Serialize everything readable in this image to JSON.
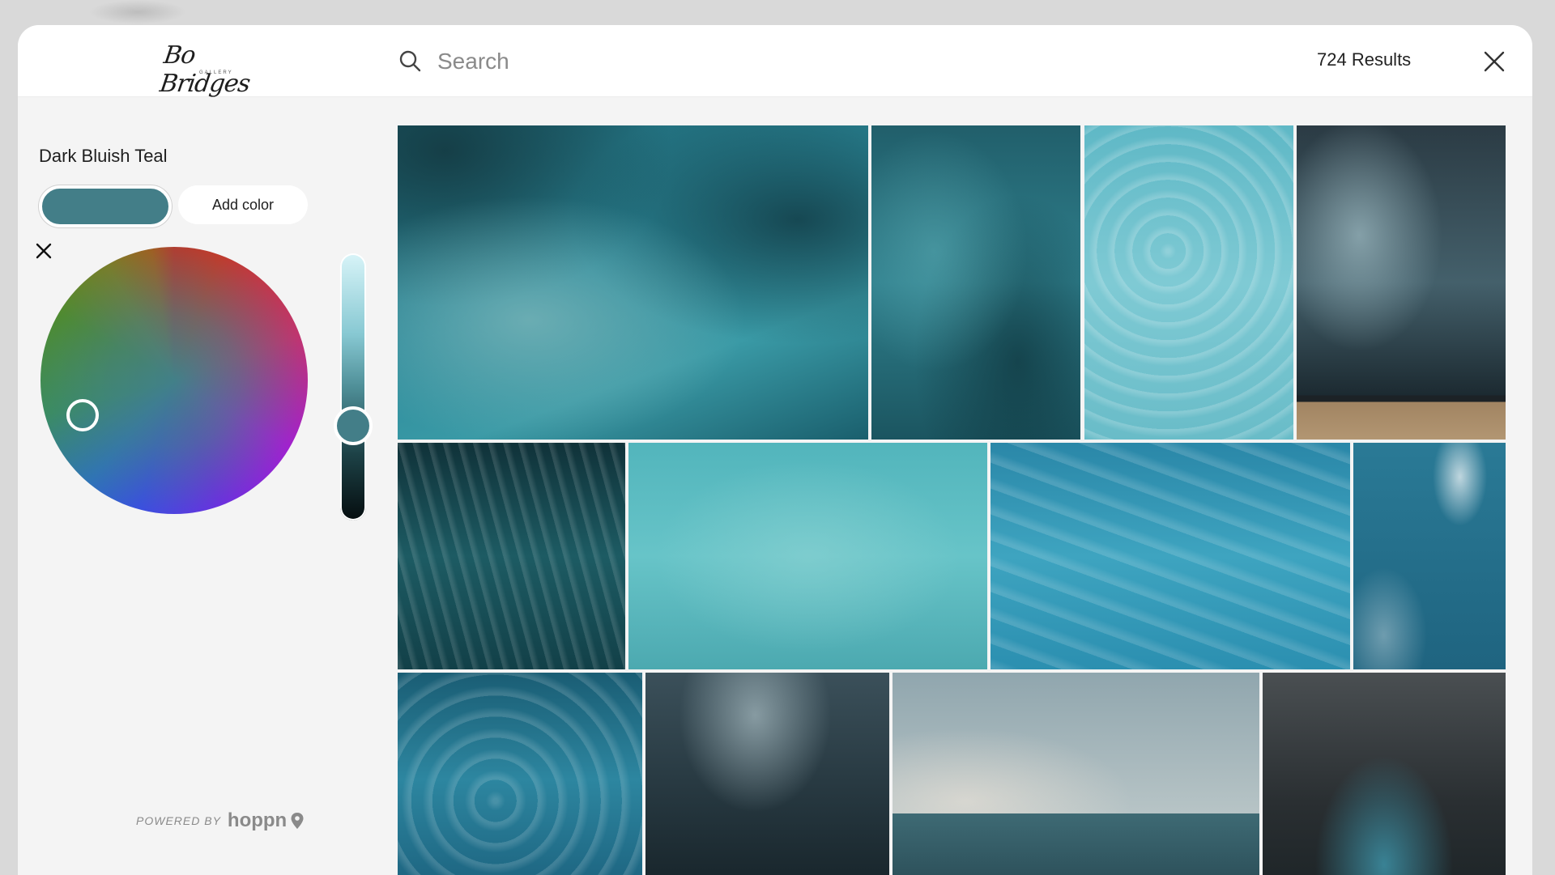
{
  "header": {
    "logo_text": "Bo Bridges",
    "logo_subtext": "GALLERY",
    "search_placeholder": "Search",
    "results_label": "724 Results",
    "icons": {
      "search": "search-icon",
      "close": "close-icon"
    }
  },
  "picker": {
    "color_name": "Dark Bluish Teal",
    "add_color_label": "Add color",
    "selected_color": "#437e88",
    "icons": {
      "remove": "close-icon"
    }
  },
  "footer": {
    "powered_prefix": "POWERED BY",
    "powered_brand": "hoppn",
    "icons": {
      "brand": "location-pin-icon"
    }
  },
  "gallery": {
    "items": [
      {
        "id": "aerial-reef-boat"
      },
      {
        "id": "aerial-reef-swimmer"
      },
      {
        "id": "sharks-shallow-water"
      },
      {
        "id": "rainbow-lifeguard-tower"
      },
      {
        "id": "surfers-whitewater-dark"
      },
      {
        "id": "surfers-turquoise-lineup"
      },
      {
        "id": "surfers-blue-waves"
      },
      {
        "id": "open-ocean-wave"
      },
      {
        "id": "surfers-crashing-wave"
      },
      {
        "id": "rainbow-storm-tower"
      },
      {
        "id": "rainbow-barrel-wave"
      },
      {
        "id": "dark-wave-spray"
      }
    ]
  },
  "colors": {
    "modal_bg": "#f4f4f4",
    "header_bg": "#ffffff",
    "accent_teal": "#437e88"
  }
}
